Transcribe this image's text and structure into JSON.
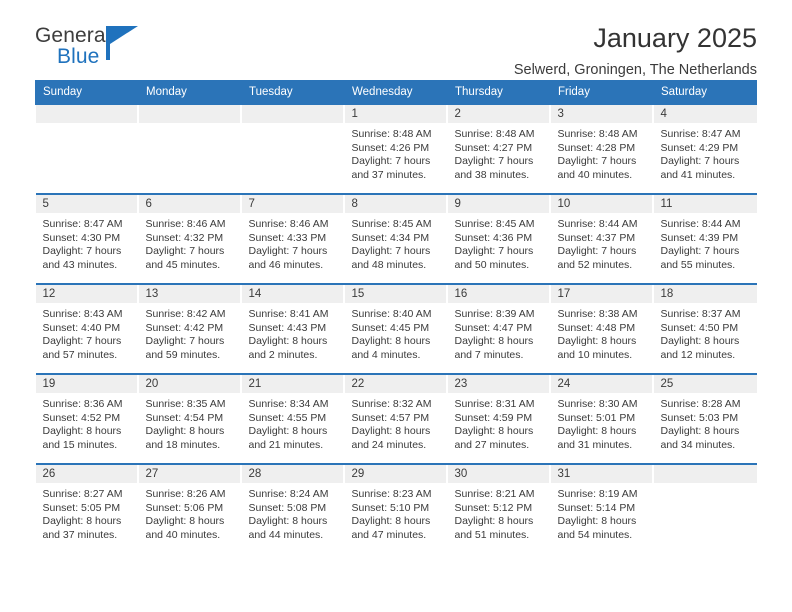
{
  "brand": {
    "name_part1": "General",
    "name_part2": "Blue",
    "accent_color": "#1f72bd"
  },
  "header": {
    "title": "January 2025",
    "subtitle": "Selwerd, Groningen, The Netherlands"
  },
  "calendar": {
    "header_color": "#2b74b8",
    "daynum_band_color": "#efefef",
    "weekdays": [
      "Sunday",
      "Monday",
      "Tuesday",
      "Wednesday",
      "Thursday",
      "Friday",
      "Saturday"
    ],
    "weeks": [
      [
        {
          "day": "",
          "empty": true,
          "sunrise": "",
          "sunset": "",
          "daylight_line1": "",
          "daylight_line2": ""
        },
        {
          "day": "",
          "empty": true,
          "sunrise": "",
          "sunset": "",
          "daylight_line1": "",
          "daylight_line2": ""
        },
        {
          "day": "",
          "empty": true,
          "sunrise": "",
          "sunset": "",
          "daylight_line1": "",
          "daylight_line2": ""
        },
        {
          "day": "1",
          "empty": false,
          "sunrise": "Sunrise: 8:48 AM",
          "sunset": "Sunset: 4:26 PM",
          "daylight_line1": "Daylight: 7 hours",
          "daylight_line2": "and 37 minutes."
        },
        {
          "day": "2",
          "empty": false,
          "sunrise": "Sunrise: 8:48 AM",
          "sunset": "Sunset: 4:27 PM",
          "daylight_line1": "Daylight: 7 hours",
          "daylight_line2": "and 38 minutes."
        },
        {
          "day": "3",
          "empty": false,
          "sunrise": "Sunrise: 8:48 AM",
          "sunset": "Sunset: 4:28 PM",
          "daylight_line1": "Daylight: 7 hours",
          "daylight_line2": "and 40 minutes."
        },
        {
          "day": "4",
          "empty": false,
          "sunrise": "Sunrise: 8:47 AM",
          "sunset": "Sunset: 4:29 PM",
          "daylight_line1": "Daylight: 7 hours",
          "daylight_line2": "and 41 minutes."
        }
      ],
      [
        {
          "day": "5",
          "empty": false,
          "sunrise": "Sunrise: 8:47 AM",
          "sunset": "Sunset: 4:30 PM",
          "daylight_line1": "Daylight: 7 hours",
          "daylight_line2": "and 43 minutes."
        },
        {
          "day": "6",
          "empty": false,
          "sunrise": "Sunrise: 8:46 AM",
          "sunset": "Sunset: 4:32 PM",
          "daylight_line1": "Daylight: 7 hours",
          "daylight_line2": "and 45 minutes."
        },
        {
          "day": "7",
          "empty": false,
          "sunrise": "Sunrise: 8:46 AM",
          "sunset": "Sunset: 4:33 PM",
          "daylight_line1": "Daylight: 7 hours",
          "daylight_line2": "and 46 minutes."
        },
        {
          "day": "8",
          "empty": false,
          "sunrise": "Sunrise: 8:45 AM",
          "sunset": "Sunset: 4:34 PM",
          "daylight_line1": "Daylight: 7 hours",
          "daylight_line2": "and 48 minutes."
        },
        {
          "day": "9",
          "empty": false,
          "sunrise": "Sunrise: 8:45 AM",
          "sunset": "Sunset: 4:36 PM",
          "daylight_line1": "Daylight: 7 hours",
          "daylight_line2": "and 50 minutes."
        },
        {
          "day": "10",
          "empty": false,
          "sunrise": "Sunrise: 8:44 AM",
          "sunset": "Sunset: 4:37 PM",
          "daylight_line1": "Daylight: 7 hours",
          "daylight_line2": "and 52 minutes."
        },
        {
          "day": "11",
          "empty": false,
          "sunrise": "Sunrise: 8:44 AM",
          "sunset": "Sunset: 4:39 PM",
          "daylight_line1": "Daylight: 7 hours",
          "daylight_line2": "and 55 minutes."
        }
      ],
      [
        {
          "day": "12",
          "empty": false,
          "sunrise": "Sunrise: 8:43 AM",
          "sunset": "Sunset: 4:40 PM",
          "daylight_line1": "Daylight: 7 hours",
          "daylight_line2": "and 57 minutes."
        },
        {
          "day": "13",
          "empty": false,
          "sunrise": "Sunrise: 8:42 AM",
          "sunset": "Sunset: 4:42 PM",
          "daylight_line1": "Daylight: 7 hours",
          "daylight_line2": "and 59 minutes."
        },
        {
          "day": "14",
          "empty": false,
          "sunrise": "Sunrise: 8:41 AM",
          "sunset": "Sunset: 4:43 PM",
          "daylight_line1": "Daylight: 8 hours",
          "daylight_line2": "and 2 minutes."
        },
        {
          "day": "15",
          "empty": false,
          "sunrise": "Sunrise: 8:40 AM",
          "sunset": "Sunset: 4:45 PM",
          "daylight_line1": "Daylight: 8 hours",
          "daylight_line2": "and 4 minutes."
        },
        {
          "day": "16",
          "empty": false,
          "sunrise": "Sunrise: 8:39 AM",
          "sunset": "Sunset: 4:47 PM",
          "daylight_line1": "Daylight: 8 hours",
          "daylight_line2": "and 7 minutes."
        },
        {
          "day": "17",
          "empty": false,
          "sunrise": "Sunrise: 8:38 AM",
          "sunset": "Sunset: 4:48 PM",
          "daylight_line1": "Daylight: 8 hours",
          "daylight_line2": "and 10 minutes."
        },
        {
          "day": "18",
          "empty": false,
          "sunrise": "Sunrise: 8:37 AM",
          "sunset": "Sunset: 4:50 PM",
          "daylight_line1": "Daylight: 8 hours",
          "daylight_line2": "and 12 minutes."
        }
      ],
      [
        {
          "day": "19",
          "empty": false,
          "sunrise": "Sunrise: 8:36 AM",
          "sunset": "Sunset: 4:52 PM",
          "daylight_line1": "Daylight: 8 hours",
          "daylight_line2": "and 15 minutes."
        },
        {
          "day": "20",
          "empty": false,
          "sunrise": "Sunrise: 8:35 AM",
          "sunset": "Sunset: 4:54 PM",
          "daylight_line1": "Daylight: 8 hours",
          "daylight_line2": "and 18 minutes."
        },
        {
          "day": "21",
          "empty": false,
          "sunrise": "Sunrise: 8:34 AM",
          "sunset": "Sunset: 4:55 PM",
          "daylight_line1": "Daylight: 8 hours",
          "daylight_line2": "and 21 minutes."
        },
        {
          "day": "22",
          "empty": false,
          "sunrise": "Sunrise: 8:32 AM",
          "sunset": "Sunset: 4:57 PM",
          "daylight_line1": "Daylight: 8 hours",
          "daylight_line2": "and 24 minutes."
        },
        {
          "day": "23",
          "empty": false,
          "sunrise": "Sunrise: 8:31 AM",
          "sunset": "Sunset: 4:59 PM",
          "daylight_line1": "Daylight: 8 hours",
          "daylight_line2": "and 27 minutes."
        },
        {
          "day": "24",
          "empty": false,
          "sunrise": "Sunrise: 8:30 AM",
          "sunset": "Sunset: 5:01 PM",
          "daylight_line1": "Daylight: 8 hours",
          "daylight_line2": "and 31 minutes."
        },
        {
          "day": "25",
          "empty": false,
          "sunrise": "Sunrise: 8:28 AM",
          "sunset": "Sunset: 5:03 PM",
          "daylight_line1": "Daylight: 8 hours",
          "daylight_line2": "and 34 minutes."
        }
      ],
      [
        {
          "day": "26",
          "empty": false,
          "sunrise": "Sunrise: 8:27 AM",
          "sunset": "Sunset: 5:05 PM",
          "daylight_line1": "Daylight: 8 hours",
          "daylight_line2": "and 37 minutes."
        },
        {
          "day": "27",
          "empty": false,
          "sunrise": "Sunrise: 8:26 AM",
          "sunset": "Sunset: 5:06 PM",
          "daylight_line1": "Daylight: 8 hours",
          "daylight_line2": "and 40 minutes."
        },
        {
          "day": "28",
          "empty": false,
          "sunrise": "Sunrise: 8:24 AM",
          "sunset": "Sunset: 5:08 PM",
          "daylight_line1": "Daylight: 8 hours",
          "daylight_line2": "and 44 minutes."
        },
        {
          "day": "29",
          "empty": false,
          "sunrise": "Sunrise: 8:23 AM",
          "sunset": "Sunset: 5:10 PM",
          "daylight_line1": "Daylight: 8 hours",
          "daylight_line2": "and 47 minutes."
        },
        {
          "day": "30",
          "empty": false,
          "sunrise": "Sunrise: 8:21 AM",
          "sunset": "Sunset: 5:12 PM",
          "daylight_line1": "Daylight: 8 hours",
          "daylight_line2": "and 51 minutes."
        },
        {
          "day": "31",
          "empty": false,
          "sunrise": "Sunrise: 8:19 AM",
          "sunset": "Sunset: 5:14 PM",
          "daylight_line1": "Daylight: 8 hours",
          "daylight_line2": "and 54 minutes."
        },
        {
          "day": "",
          "empty": true,
          "sunrise": "",
          "sunset": "",
          "daylight_line1": "",
          "daylight_line2": ""
        }
      ]
    ]
  }
}
